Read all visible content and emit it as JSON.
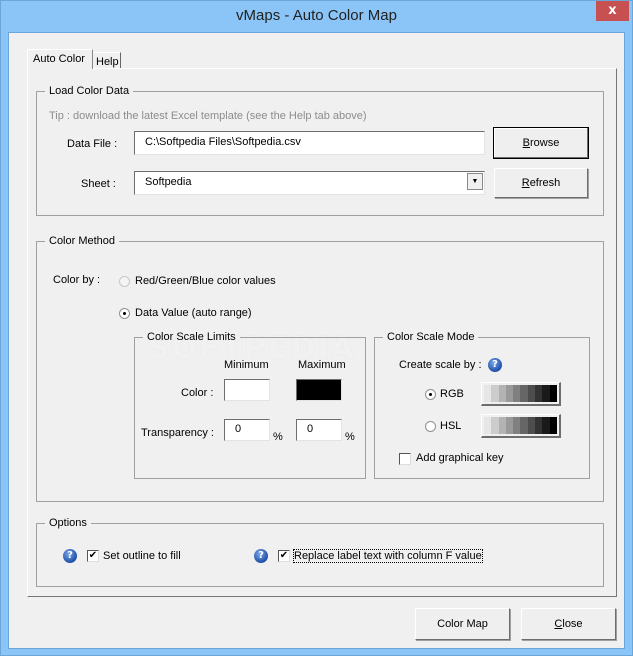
{
  "window": {
    "title": "vMaps - Auto Color Map",
    "close_glyph": "x"
  },
  "tabs": [
    {
      "label": "Auto Color",
      "active": true
    },
    {
      "label": "Help",
      "active": false
    }
  ],
  "load_color_data": {
    "legend": "Load Color Data",
    "tip": "Tip : download the latest Excel template (see the Help tab above)",
    "data_file_label": "Data File :",
    "data_file_value": "C:\\Softpedia Files\\Softpedia.csv",
    "sheet_label": "Sheet :",
    "sheet_value": "Softpedia",
    "dropdown_glyph": "▼",
    "browse_button": {
      "accel": "B",
      "rest": "rowse"
    },
    "refresh_button": {
      "accel": "R",
      "rest": "efresh"
    }
  },
  "color_method": {
    "legend": "Color Method",
    "color_by_label": "Color by :",
    "options": [
      {
        "label": "Red/Green/Blue color values",
        "selected": false,
        "enabled": false
      },
      {
        "label": "Data Value (auto range)",
        "selected": true,
        "enabled": true
      }
    ],
    "watermark": "SOFTPEDIA",
    "scale_limits": {
      "legend": "Color Scale Limits",
      "minimum_label": "Minimum",
      "maximum_label": "Maximum",
      "color_label": "Color :",
      "min_color": "#ffffff",
      "max_color": "#000000",
      "transparency_label": "Transparency :",
      "min_transparency": "0",
      "max_transparency": "0",
      "percent": "%"
    },
    "scale_mode": {
      "legend": "Color Scale Mode",
      "create_label": "Create scale by :",
      "help_glyph": "?",
      "options": [
        {
          "label": "RGB",
          "selected": true
        },
        {
          "label": "HSL",
          "selected": false
        }
      ],
      "gradient_steps": [
        "#e6e6e6",
        "#cccccc",
        "#b3b3b3",
        "#999999",
        "#808080",
        "#666666",
        "#4d4d4d",
        "#333333",
        "#1a1a1a",
        "#000000"
      ],
      "graphical_key_label": "Add graphical key",
      "graphical_key_checked": false
    }
  },
  "options": {
    "legend": "Options",
    "items": [
      {
        "label": "Set outline to fill",
        "checked": true
      },
      {
        "label": "Replace label text with column F value",
        "checked": true
      }
    ],
    "check_glyph": "✔",
    "help_glyph": "?"
  },
  "footer": {
    "color_map_button": "Color Map",
    "close_button": {
      "accel": "C",
      "rest": "lose"
    }
  }
}
